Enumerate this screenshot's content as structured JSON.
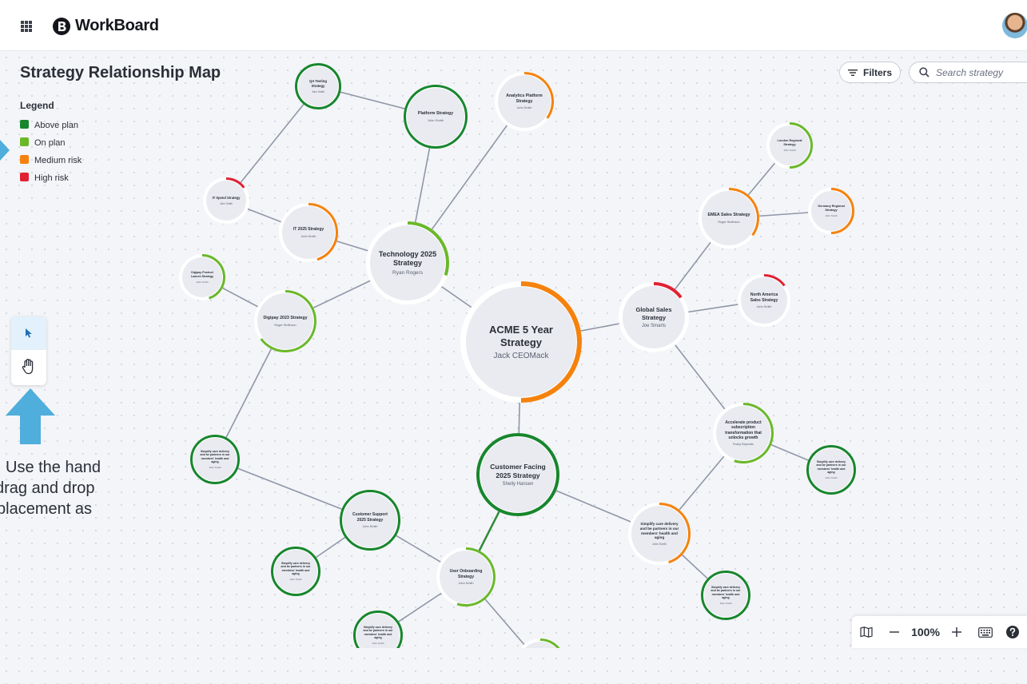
{
  "app": {
    "brand": "WorkBoard"
  },
  "page": {
    "title": "Strategy Relationship Map"
  },
  "legend": {
    "title": "Legend",
    "items": [
      {
        "label": "Above plan",
        "color": "#17862d"
      },
      {
        "label": "On plan",
        "color": "#6ab82a"
      },
      {
        "label": "Medium risk",
        "color": "#f5820d"
      },
      {
        "label": "High risk",
        "color": "#e02232"
      }
    ]
  },
  "toolbar": {
    "filters_label": "Filters",
    "search_placeholder": "Search strategy"
  },
  "hint": {
    "lines": [
      "Use the hand",
      "drag and drop",
      "placement as"
    ]
  },
  "zoom": {
    "level": "100%"
  },
  "statuses": {
    "above": "#17862d",
    "on": "#6ab82a",
    "medium": "#f5820d",
    "high": "#e02232"
  },
  "nodes": [
    {
      "id": "acme",
      "title": "ACME 5 Year Strategy",
      "owner": "Jack CEOMack",
      "status": "medium",
      "progress": 0.5
    },
    {
      "id": "tech",
      "title": "Technology 2025 Strategy",
      "owner": "Ryan Rogers",
      "status": "on",
      "progress": 0.3
    },
    {
      "id": "global",
      "title": "Global Sales Strategy",
      "owner": "Joe Smarts",
      "status": "high",
      "progress": 0.15
    },
    {
      "id": "cust",
      "title": "Customer Facing 2025 Strategy",
      "owner": "Shelly Hansen",
      "status": "above",
      "progress": 1.0
    },
    {
      "id": "qa",
      "title": "QA Testing Strategy",
      "owner": "John Smith",
      "status": "above",
      "progress": 1.0
    },
    {
      "id": "platform",
      "title": "Platform Strategy",
      "owner": "John Smith",
      "status": "above",
      "progress": 1.0
    },
    {
      "id": "analytics",
      "title": "Analytics Platform Strategy",
      "owner": "John Smith",
      "status": "medium",
      "progress": 0.35
    },
    {
      "id": "itspend",
      "title": "IT Spend Strategy",
      "owner": "John Smith",
      "status": "high",
      "progress": 0.15
    },
    {
      "id": "it2025",
      "title": "IT 2025 Strategy",
      "owner": "John Smith",
      "status": "medium",
      "progress": 0.45
    },
    {
      "id": "digipaylaunch",
      "title": "Digipay Product Launch Strategy",
      "owner": "John Smith",
      "status": "on",
      "progress": 0.45
    },
    {
      "id": "digipay2023",
      "title": "Digipay 2023 Strategy",
      "owner": "Roger Smithson",
      "status": "on",
      "progress": 0.65
    },
    {
      "id": "london",
      "title": "London Regional Strategy",
      "owner": "John Smith",
      "status": "on",
      "progress": 0.5
    },
    {
      "id": "emea",
      "title": "EMEA Sales Strategy",
      "owner": "Roger Smithson",
      "status": "medium",
      "progress": 0.35
    },
    {
      "id": "germany",
      "title": "Germany Regional Strategy",
      "owner": "John Smith",
      "status": "medium",
      "progress": 0.5
    },
    {
      "id": "northam",
      "title": "North America Sales Strategy",
      "owner": "John Smith",
      "status": "high",
      "progress": 0.15
    },
    {
      "id": "accel",
      "title": "Accelerate product subscription transformation that unlocks growth",
      "owner": "Rocky Reynolds",
      "status": "on",
      "progress": 0.55
    },
    {
      "id": "simp_right",
      "title": "Simplify care delivery and be partners in our members' health and aging",
      "owner": "John Smith",
      "status": "above",
      "progress": 1.0
    },
    {
      "id": "simp_left",
      "title": "Simplify care delivery and be partners in our members' health and aging",
      "owner": "John Smith",
      "status": "above",
      "progress": 1.0
    },
    {
      "id": "support",
      "title": "Customer Support 2025 Strategy",
      "owner": "John Smith",
      "status": "above",
      "progress": 1.0
    },
    {
      "id": "simp_mid",
      "title": "Simplify care delivery and be partners in our members' health and aging",
      "owner": "John Smith",
      "status": "medium",
      "progress": 0.45
    },
    {
      "id": "simp_lowleft",
      "title": "Simplify care delivery and be partners in our members' health and aging",
      "owner": "John Smith",
      "status": "above",
      "progress": 1.0
    },
    {
      "id": "onboard",
      "title": "User Onboarding Strategy",
      "owner": "John Smith",
      "status": "on",
      "progress": 0.55
    },
    {
      "id": "simp_lowright",
      "title": "Simplify care delivery and be partners in our members' health and aging",
      "owner": "John Smith",
      "status": "above",
      "progress": 1.0
    },
    {
      "id": "simp_bottom",
      "title": "Simplify care delivery and be partners in our members' health and aging",
      "owner": "John Smith",
      "status": "above",
      "progress": 1.0
    },
    {
      "id": "bottom_partial",
      "title": "",
      "owner": "",
      "status": "on",
      "progress": 0.3
    }
  ],
  "edges": [
    [
      "acme",
      "tech"
    ],
    [
      "acme",
      "global"
    ],
    [
      "acme",
      "cust"
    ],
    [
      "tech",
      "platform"
    ],
    [
      "tech",
      "analytics"
    ],
    [
      "tech",
      "it2025"
    ],
    [
      "tech",
      "digipay2023"
    ],
    [
      "platform",
      "qa"
    ],
    [
      "qa",
      "itspend"
    ],
    [
      "it2025",
      "itspend"
    ],
    [
      "digipay2023",
      "digipaylaunch"
    ],
    [
      "digipay2023",
      "simp_left"
    ],
    [
      "global",
      "emea"
    ],
    [
      "global",
      "northam"
    ],
    [
      "global",
      "accel"
    ],
    [
      "emea",
      "london"
    ],
    [
      "emea",
      "germany"
    ],
    [
      "accel",
      "simp_right"
    ],
    [
      "accel",
      "simp_mid"
    ],
    [
      "cust",
      "onboard"
    ],
    [
      "cust",
      "simp_mid"
    ],
    [
      "simp_left",
      "support"
    ],
    [
      "support",
      "onboard"
    ],
    [
      "support",
      "simp_lowleft"
    ],
    [
      "onboard",
      "simp_bottom"
    ],
    [
      "onboard",
      "bottom_partial"
    ],
    [
      "simp_mid",
      "simp_lowright"
    ]
  ]
}
